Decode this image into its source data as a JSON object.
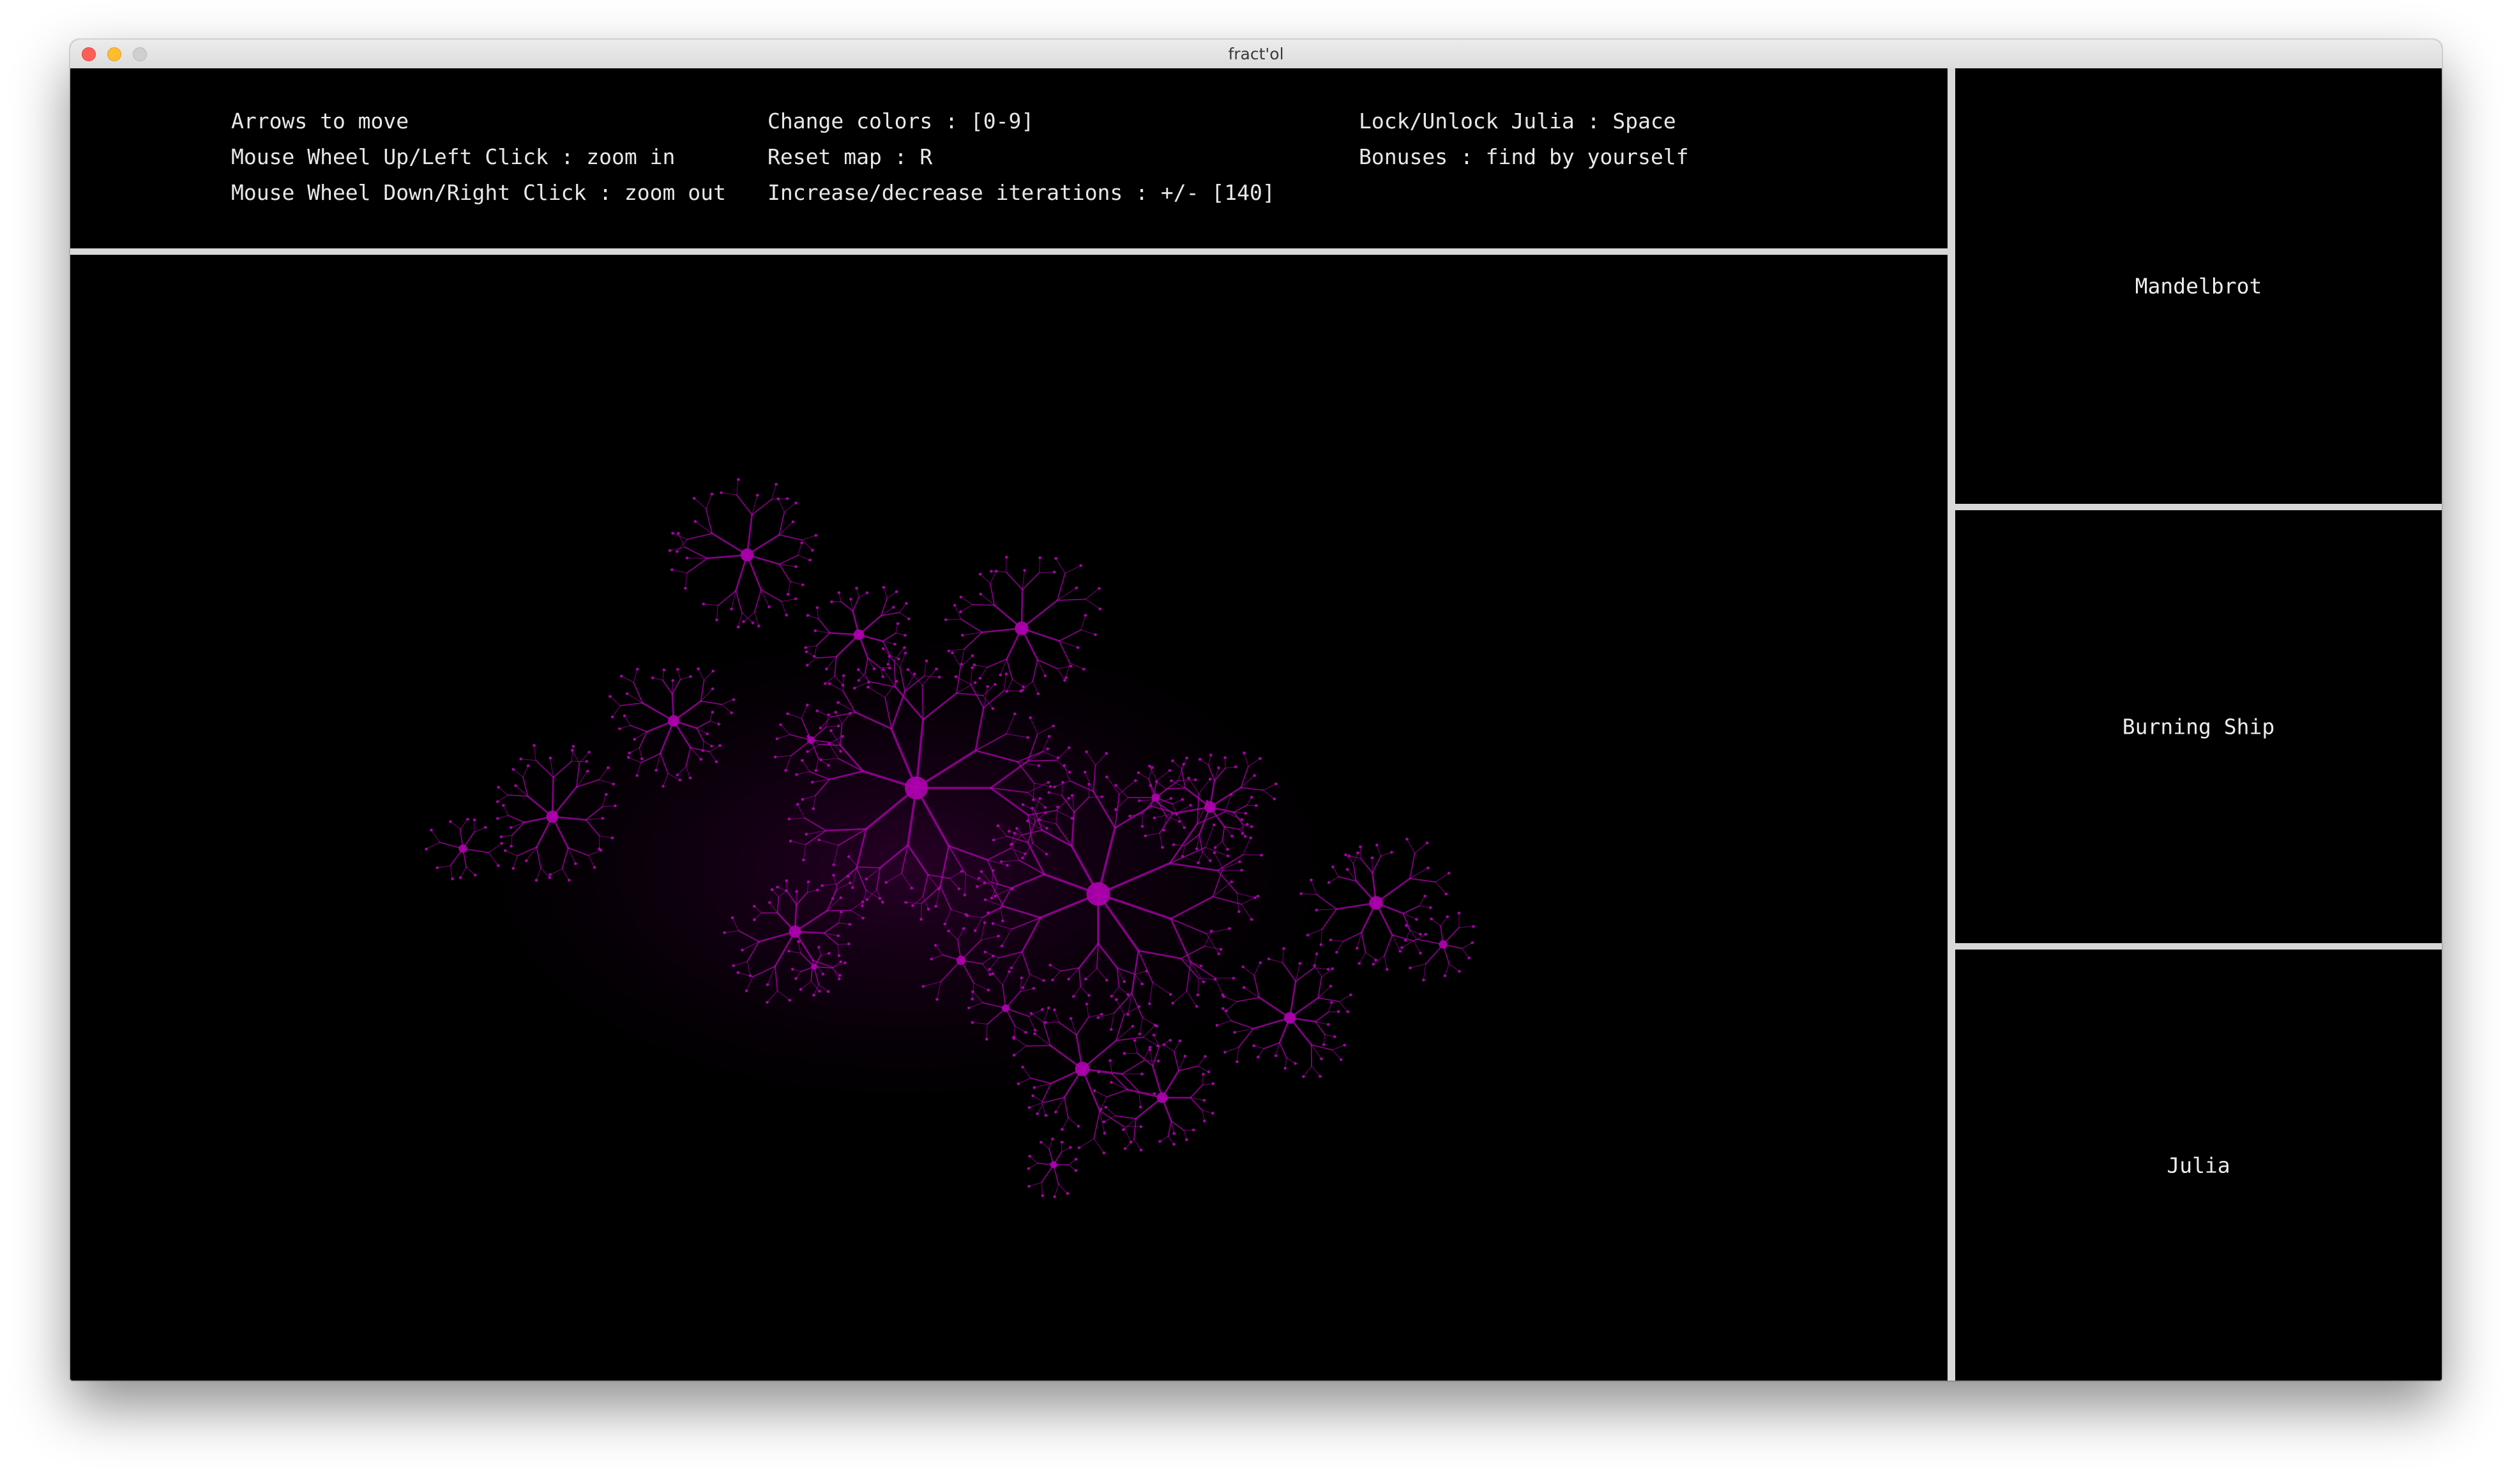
{
  "window": {
    "title": "fract'ol"
  },
  "instructions": {
    "column1": [
      "Arrows to move",
      "Mouse Wheel Up/Left Click : zoom in",
      "Mouse Wheel Down/Right Click : zoom out"
    ],
    "column2": [
      "Change colors : [0-9]",
      "Reset map : R",
      "Increase/decrease iterations : +/- [140]"
    ],
    "column3": [
      "Lock/Unlock Julia : Space",
      "Bonuses : find by yourself"
    ]
  },
  "sidebar": {
    "fractals": [
      {
        "label": "Mandelbrot"
      },
      {
        "label": "Burning Ship"
      },
      {
        "label": "Julia"
      }
    ]
  },
  "render": {
    "fractal_color": "#b000b0",
    "background_color": "#000000",
    "iterations": 140
  }
}
